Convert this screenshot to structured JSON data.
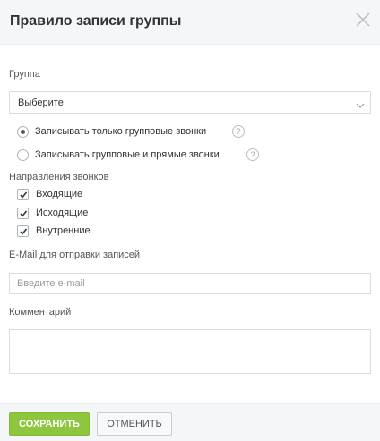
{
  "dialog": {
    "title": "Правило записи группы"
  },
  "group": {
    "label": "Группа",
    "selected": "Выберите"
  },
  "record_mode": {
    "options": [
      {
        "label": "Записывать только групповые звонки",
        "checked": true
      },
      {
        "label": "Записывать групповые и прямые звонки",
        "checked": false
      }
    ],
    "help_glyph": "?"
  },
  "directions": {
    "label": "Направления звонков",
    "items": [
      {
        "label": "Входящие",
        "checked": true
      },
      {
        "label": "Исходящие",
        "checked": true
      },
      {
        "label": "Внутренние",
        "checked": true
      }
    ]
  },
  "email": {
    "label": "E-Mail для отправки записей",
    "placeholder": "Введите e-mail",
    "value": ""
  },
  "comment": {
    "label": "Комментарий",
    "value": ""
  },
  "footer": {
    "save_label": "СОХРАНИТЬ",
    "cancel_label": "ОТМЕНИТЬ"
  },
  "colors": {
    "save_button": "#8ec63f",
    "header_bg": "#f5f6f8"
  }
}
